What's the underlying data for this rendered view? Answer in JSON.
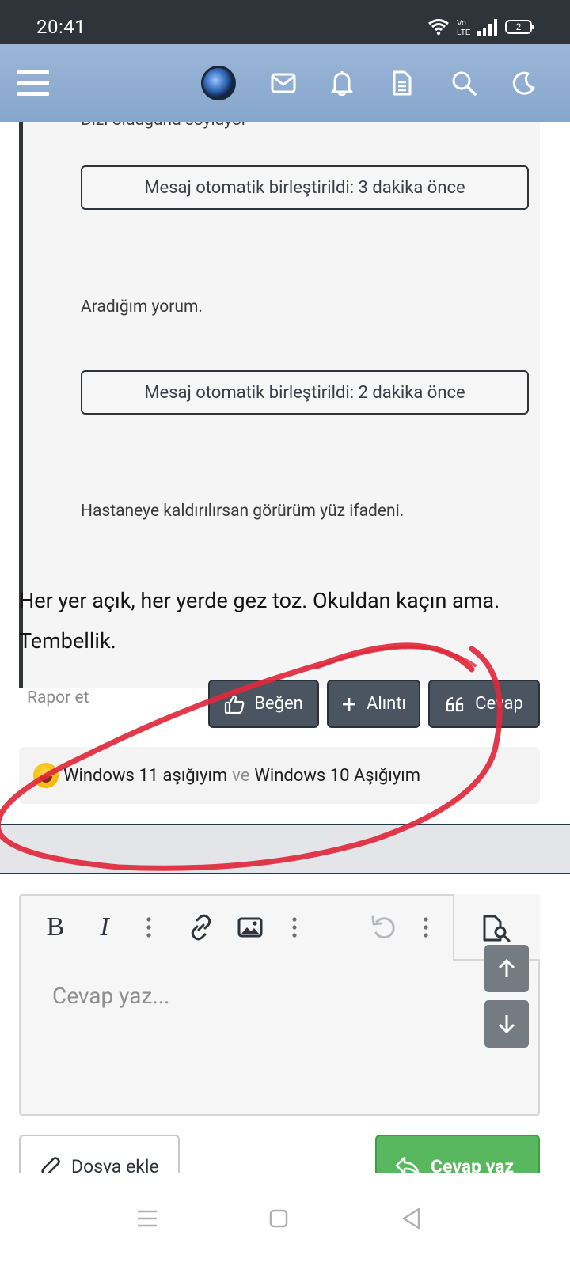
{
  "status_bar": {
    "time": "20:41",
    "battery": "2",
    "network_label": "Vo LTE"
  },
  "header": {
    "icons": [
      "menu-icon",
      "globe-avatar",
      "mail-icon",
      "bell-icon",
      "document-icon",
      "search-icon",
      "moon-icon"
    ]
  },
  "quote": {
    "partial_top_text": "Dizi olduğunu söylüyor",
    "merge_notice_1": "Mesaj otomatik birleştirildi: 3 dakika önce",
    "line_2": "Aradığım yorum.",
    "merge_notice_2": "Mesaj otomatik birleştirildi: 2 dakika önce",
    "line_3": "Hastaneye kaldırılırsan görürüm yüz ifadeni."
  },
  "post": {
    "text": "Her yer açık, her yerde gez toz. Okuldan kaçın ama. Tembellik."
  },
  "actions": {
    "report": "Rapor et",
    "like": "Beğen",
    "quote": "Alıntı",
    "reply": "Cevap"
  },
  "reactions": {
    "user_1": "Windows 11 aşığıyım",
    "joiner": "ve",
    "user_2": "Windows 10 Aşığıyım"
  },
  "editor": {
    "placeholder": "Cevap yaz...",
    "bold": "B",
    "italic": "I"
  },
  "footer": {
    "attach_label": "Dosya ekle",
    "submit_label": "Cevap yaz"
  },
  "colors": {
    "header_bg": "#8aaad0",
    "button_dark": "#4b5561",
    "submit_green": "#58b75f",
    "annotation_red": "#e0283c"
  }
}
